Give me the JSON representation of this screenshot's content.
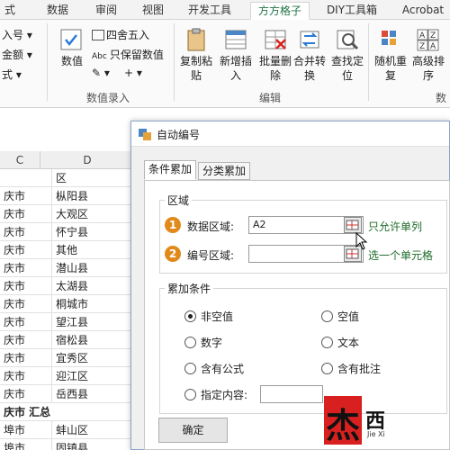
{
  "ribbon_tabs": [
    "式",
    "数据",
    "审阅",
    "视图",
    "开发工具",
    "方方格子",
    "DIY工具箱",
    "Acrobat"
  ],
  "active_tab": "方方格子",
  "ribbon": {
    "left_items": [
      "入号 ▾",
      "金额 ▾",
      "式 ▾"
    ],
    "value_btn": "数值",
    "round_label": "四舍五入",
    "keep_label": "只保留数值",
    "op_symbols": [
      "✎ ▾",
      "+ ▾"
    ],
    "group_numeric": "数值录入",
    "copy_paste": "复制粘贴",
    "new_insert": "新增插入",
    "bulk_delete": "批量删除",
    "merge_convert": "合并转换",
    "find_locate": "查找定位",
    "group_edit": "编辑",
    "random_repeat": "随机重复",
    "advanced_sort": "高级排序",
    "group_right": "数"
  },
  "sheet": {
    "col_c": "C",
    "col_d": "D",
    "header_d": "区",
    "rows": [
      [
        "庆市",
        "枞阳县"
      ],
      [
        "庆市",
        "大观区"
      ],
      [
        "庆市",
        "怀宁县"
      ],
      [
        "庆市",
        "其他"
      ],
      [
        "庆市",
        "潜山县"
      ],
      [
        "庆市",
        "太湖县"
      ],
      [
        "庆市",
        "桐城市"
      ],
      [
        "庆市",
        "望江县"
      ],
      [
        "庆市",
        "宿松县"
      ],
      [
        "庆市",
        "宜秀区"
      ],
      [
        "庆市",
        "迎江区"
      ],
      [
        "庆市",
        "岳西县"
      ],
      [
        "庆市 汇总",
        ""
      ],
      [
        "埠市",
        "蚌山区"
      ],
      [
        "埠市",
        "固镇县"
      ]
    ]
  },
  "dialog": {
    "title": "自动编号",
    "tab_1": "条件累加",
    "tab_2": "分类累加",
    "section_area": "区域",
    "num_1": "1",
    "data_area_label": "数据区域:",
    "data_area_value": "A2",
    "data_hint": "只允许单列",
    "num_2": "2",
    "num_area_label": "编号区域:",
    "num_area_value": "",
    "num_hint": "选一个单元格",
    "section_cond": "累加条件",
    "opt_nonempty": "非空值",
    "opt_empty": "空值",
    "opt_number": "数字",
    "opt_text": "文本",
    "opt_formula": "含有公式",
    "opt_comment": "含有批注",
    "opt_specified": "指定内容:",
    "ok": "确定"
  },
  "watermark": {
    "big_char": "杰",
    "small_char": "西",
    "caption": "Jie Xi"
  }
}
